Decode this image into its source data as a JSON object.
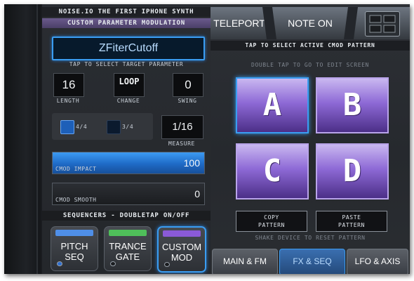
{
  "header": {
    "title": "NOISE.IO THE FIRST IPHONE SYNTH",
    "subtitle": "CUSTOM PARAMETER MODULATION"
  },
  "target": {
    "value": "ZFiterCutoff",
    "caption": "TAP TO SELECT TARGET PARAMETER"
  },
  "params": {
    "length": {
      "value": "16",
      "label": "LENGTH"
    },
    "change": {
      "value": "LOOP",
      "label": "CHANGE"
    },
    "swing": {
      "value": "0",
      "label": "SWING"
    }
  },
  "time_sig": {
    "opt1": {
      "label": "4/4",
      "selected": true
    },
    "opt2": {
      "label": "3/4",
      "selected": false
    }
  },
  "measure": {
    "value": "1/16",
    "label": "MEASURE"
  },
  "cmod_impact": {
    "label": "CMOD IMPACT",
    "value": "100",
    "level": 1.0
  },
  "cmod_smooth": {
    "label": "CMOD SMOOTH",
    "value": "0",
    "level": 0.0
  },
  "sequencers": {
    "header": "SEQUENCERS - DOUBLETAP ON/OFF",
    "items": [
      {
        "line1": "PITCH",
        "line2": "SEQ",
        "color": "#4f8fe8",
        "active": false
      },
      {
        "line1": "TRANCE",
        "line2": "GATE",
        "color": "#4fbf5a",
        "active": false
      },
      {
        "line1": "CUSTOM",
        "line2": "MOD",
        "color": "#8a5ad8",
        "active": true
      }
    ]
  },
  "top": {
    "teleport": "TELEPORT",
    "note_on": "NOTE ON",
    "grid_icon": "grid-icon"
  },
  "cmod": {
    "header": "TAP TO SELECT ACTIVE CMOD PATTERN",
    "hint": "DOUBLE TAP TO GO TO EDIT SCREEN",
    "patterns": [
      "A",
      "B",
      "C",
      "D"
    ],
    "selected": "A",
    "copy": {
      "line1": "COPY",
      "line2": "PATTERN"
    },
    "paste": {
      "line1": "PASTE",
      "line2": "PATTERN"
    },
    "shake_hint": "SHAKE DEVICE TO RESET PATTERN"
  },
  "tabs": [
    "MAIN & FM",
    "FX & SEQ",
    "LFO & AXIS"
  ],
  "active_tab": "FX & SEQ",
  "colors": {
    "accent_blue": "#3a9df2",
    "pad_purple": "#8e6ad6"
  }
}
